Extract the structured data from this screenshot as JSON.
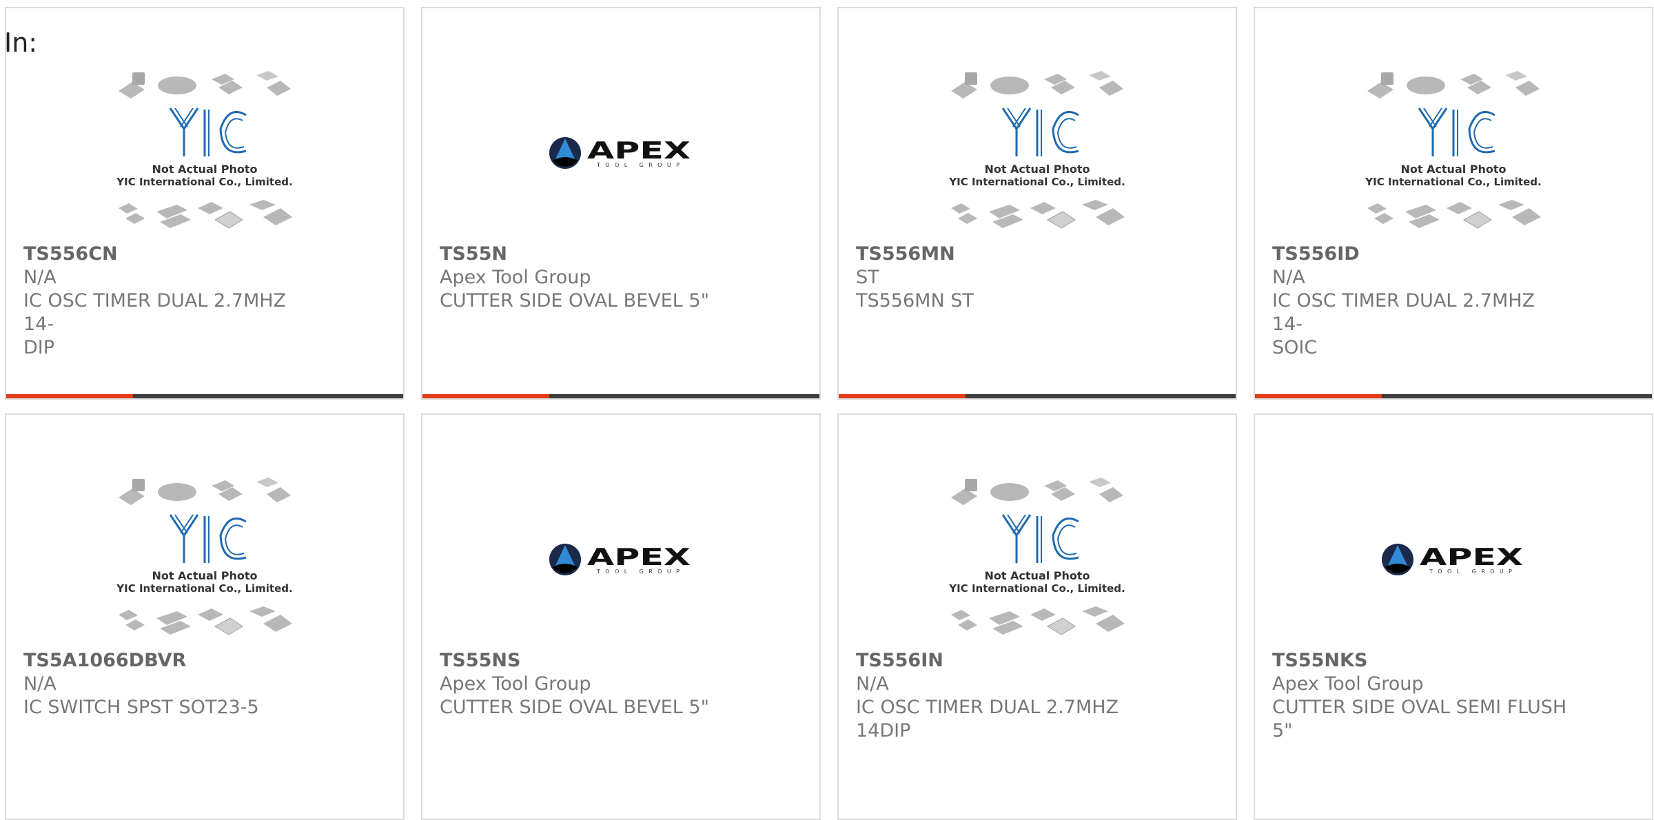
{
  "header": {
    "label": "In:"
  },
  "colors": {
    "accent": "#e23c14",
    "bar": "#3d3d3d",
    "yic_blue": "#1e6ab0"
  },
  "placeholder": {
    "line1": "Not Actual Photo",
    "line2": "YIC International Co., Limited."
  },
  "apex_logo": {
    "word": "APEX",
    "sub": "TOOL GROUP"
  },
  "products": [
    {
      "part": "TS556CN",
      "mfr": "N/A",
      "desc1": "IC OSC TIMER DUAL 2.7MHZ 14-",
      "desc2": "DIP",
      "image": "yic",
      "progress": 0.32
    },
    {
      "part": "TS55N",
      "mfr": "Apex Tool Group",
      "desc1": "CUTTER SIDE OVAL BEVEL 5\"",
      "desc2": "",
      "image": "apex",
      "progress": 0.32
    },
    {
      "part": "TS556MN",
      "mfr": "ST",
      "desc1": "TS556MN ST",
      "desc2": "",
      "image": "yic",
      "progress": 0.32
    },
    {
      "part": "TS556ID",
      "mfr": "N/A",
      "desc1": "IC OSC TIMER DUAL 2.7MHZ 14-",
      "desc2": "SOIC",
      "image": "yic",
      "progress": 0.32
    },
    {
      "part": "TS5A1066DBVR",
      "mfr": "N/A",
      "desc1": "IC SWITCH SPST SOT23-5",
      "desc2": "",
      "image": "yic"
    },
    {
      "part": "TS55NS",
      "mfr": "Apex Tool Group",
      "desc1": "CUTTER SIDE OVAL BEVEL 5\"",
      "desc2": "",
      "image": "apex"
    },
    {
      "part": "TS556IN",
      "mfr": "N/A",
      "desc1": "IC OSC TIMER DUAL 2.7MHZ",
      "desc2": "14DIP",
      "image": "yic"
    },
    {
      "part": "TS55NKS",
      "mfr": "Apex Tool Group",
      "desc1": "CUTTER SIDE OVAL SEMI FLUSH",
      "desc2": "5\"",
      "image": "apex"
    }
  ]
}
